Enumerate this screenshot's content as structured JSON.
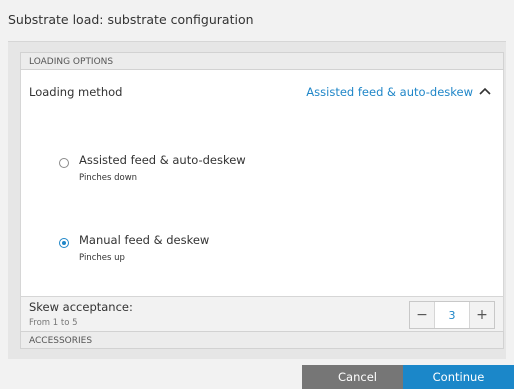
{
  "window": {
    "title": "Substrate load: substrate configuration"
  },
  "sections": {
    "loading_options": "LOADING OPTIONS",
    "accessories": "ACCESSORIES"
  },
  "loading_method": {
    "label": "Loading method",
    "value": "Assisted feed & auto-deskew",
    "options": [
      {
        "title": "Assisted feed & auto-deskew",
        "subtitle": "Pinches down",
        "selected": false
      },
      {
        "title": "Manual feed & deskew",
        "subtitle": "Pinches up",
        "selected": true
      }
    ]
  },
  "skew": {
    "label": "Skew acceptance:",
    "range": "From 1 to 5",
    "value": "3",
    "minus": "−",
    "plus": "+"
  },
  "footer": {
    "cancel": "Cancel",
    "continue": "Continue"
  },
  "colors": {
    "accent": "#1f86c8",
    "cancel_bg": "#767676",
    "continue_bg": "#1b87c9"
  }
}
